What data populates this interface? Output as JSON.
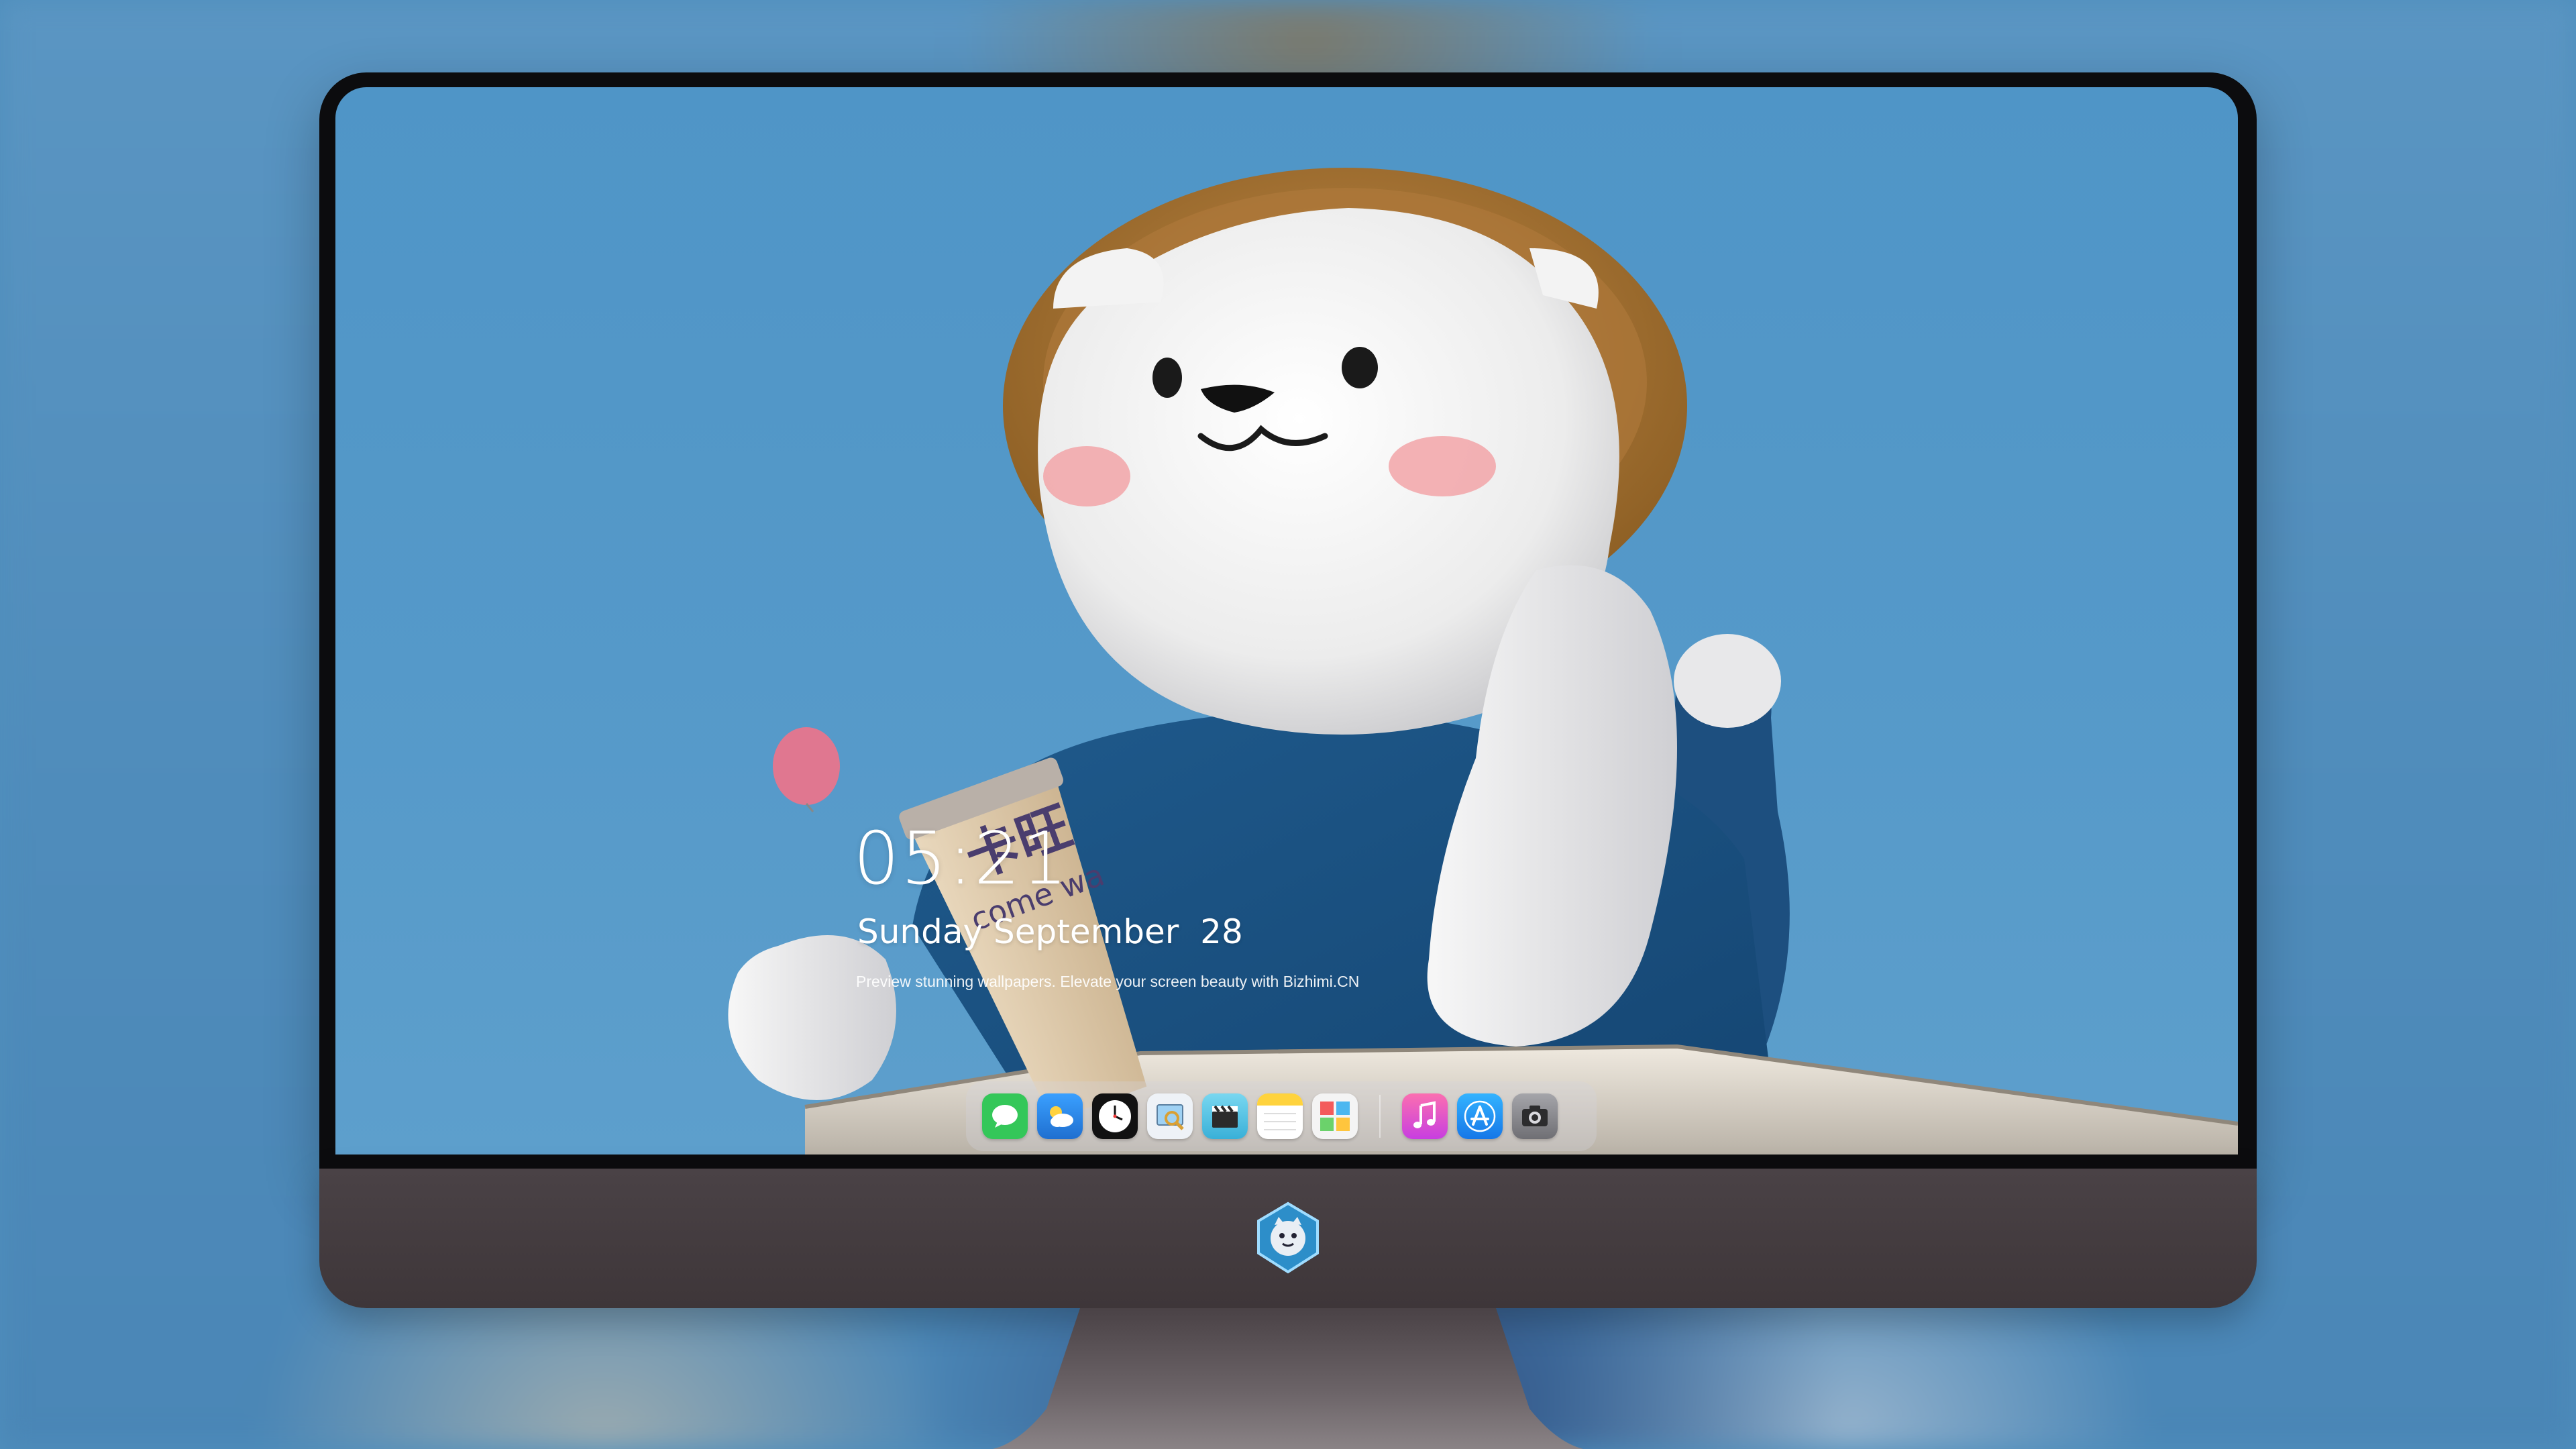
{
  "lockscreen": {
    "time": "05:21",
    "date": "Sunday September  28",
    "caption": "Preview stunning wallpapers. Elevate your screen beauty with  Bizhimi.CN"
  },
  "wallpaper": {
    "cup_text_cn": "卡旺",
    "cup_text_en": "come wa"
  },
  "dock": {
    "apps": [
      {
        "name": "Messages",
        "icon": "messages-icon",
        "color": "#34c759"
      },
      {
        "name": "Weather",
        "icon": "weather-icon",
        "color": "#2f8ff0"
      },
      {
        "name": "Clock",
        "icon": "clock-icon",
        "color": "#111111"
      },
      {
        "name": "Preview",
        "icon": "preview-icon",
        "color": "#e9eef5"
      },
      {
        "name": "Clips",
        "icon": "clapperboard-icon",
        "color": "#5ac8e6"
      },
      {
        "name": "Notes",
        "icon": "notes-icon",
        "color": "#ffd33d"
      },
      {
        "name": "Photo Booth",
        "icon": "photo-booth-icon",
        "color": "#f2f2f2"
      },
      {
        "name": "Music",
        "icon": "music-icon",
        "color": "#fa4f9a"
      },
      {
        "name": "App Store",
        "icon": "app-store-icon",
        "color": "#1b8ef5"
      },
      {
        "name": "Camera",
        "icon": "camera-icon",
        "color": "#8c8c90"
      }
    ]
  },
  "colors": {
    "sky": "#5599c9",
    "bezel": "#0c0c0e",
    "chin": "#443c40"
  }
}
